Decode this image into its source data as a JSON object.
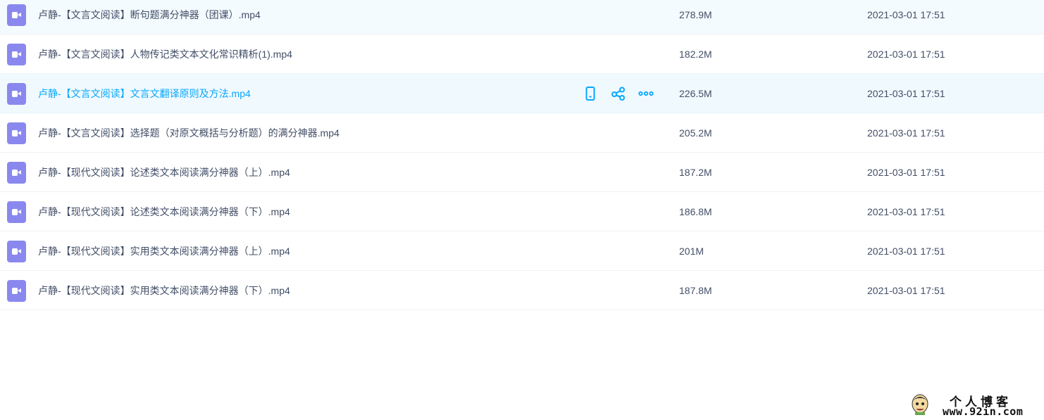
{
  "files": [
    {
      "name": "卢静-【文言文阅读】断句题满分神器（团课）.mp4",
      "size": "278.9M",
      "modified": "2021-03-01 17:51",
      "icon": "video-file-icon"
    },
    {
      "name": "卢静-【文言文阅读】人物传记类文本文化常识精析(1).mp4",
      "size": "182.2M",
      "modified": "2021-03-01 17:51",
      "icon": "video-file-icon"
    },
    {
      "name": "卢静-【文言文阅读】文言文翻译原则及方法.mp4",
      "size": "226.5M",
      "modified": "2021-03-01 17:51",
      "icon": "video-file-icon"
    },
    {
      "name": "卢静-【文言文阅读】选择题（对原文概括与分析题）的满分神器.mp4",
      "size": "205.2M",
      "modified": "2021-03-01 17:51",
      "icon": "video-file-icon"
    },
    {
      "name": "卢静-【现代文阅读】论述类文本阅读满分神器（上）.mp4",
      "size": "187.2M",
      "modified": "2021-03-01 17:51",
      "icon": "video-file-icon"
    },
    {
      "name": "卢静-【现代文阅读】论述类文本阅读满分神器（下）.mp4",
      "size": "186.8M",
      "modified": "2021-03-01 17:51",
      "icon": "video-file-icon"
    },
    {
      "name": "卢静-【现代文阅读】实用类文本阅读满分神器（上）.mp4",
      "size": "201M",
      "modified": "2021-03-01 17:51",
      "icon": "video-file-icon"
    },
    {
      "name": "卢静-【现代文阅读】实用类文本阅读满分神器（下）.mp4",
      "size": "187.8M",
      "modified": "2021-03-01 17:51",
      "icon": "video-file-icon"
    }
  ],
  "hovered_row_actions": [
    "phone-icon",
    "share-icon",
    "more-icon"
  ],
  "watermark": {
    "title": "个人博客",
    "url": "www.92in.com"
  },
  "colors": {
    "accent": "#06a7ff",
    "text": "#424e67",
    "video_icon": "#8a88ee",
    "hover_bg": "#f0f9fe"
  }
}
